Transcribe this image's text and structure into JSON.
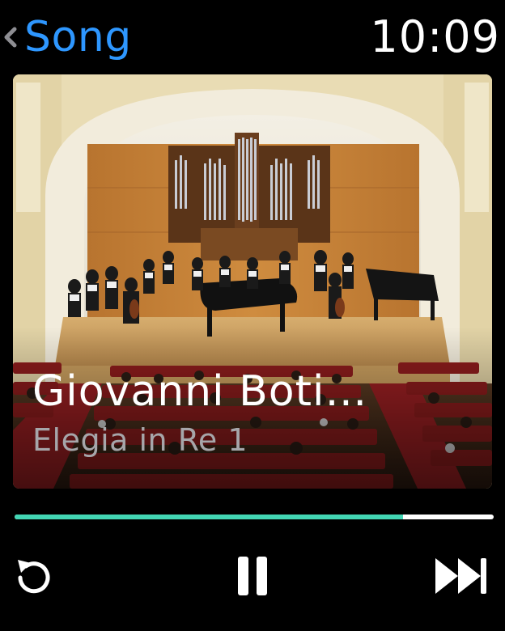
{
  "header": {
    "back_label": "Song",
    "time": "10:09"
  },
  "now_playing": {
    "title": "Giovanni Boti…",
    "subtitle": "Elegia in Re 1",
    "progress_fraction": 0.81
  },
  "controls": {
    "replay_icon": "replay-icon",
    "pause_icon": "pause-icon",
    "next_icon": "skip-forward-icon"
  },
  "colors": {
    "accent": "#2e97ff",
    "progress": "#43d6b4",
    "subtitle": "#a6a6aa"
  }
}
